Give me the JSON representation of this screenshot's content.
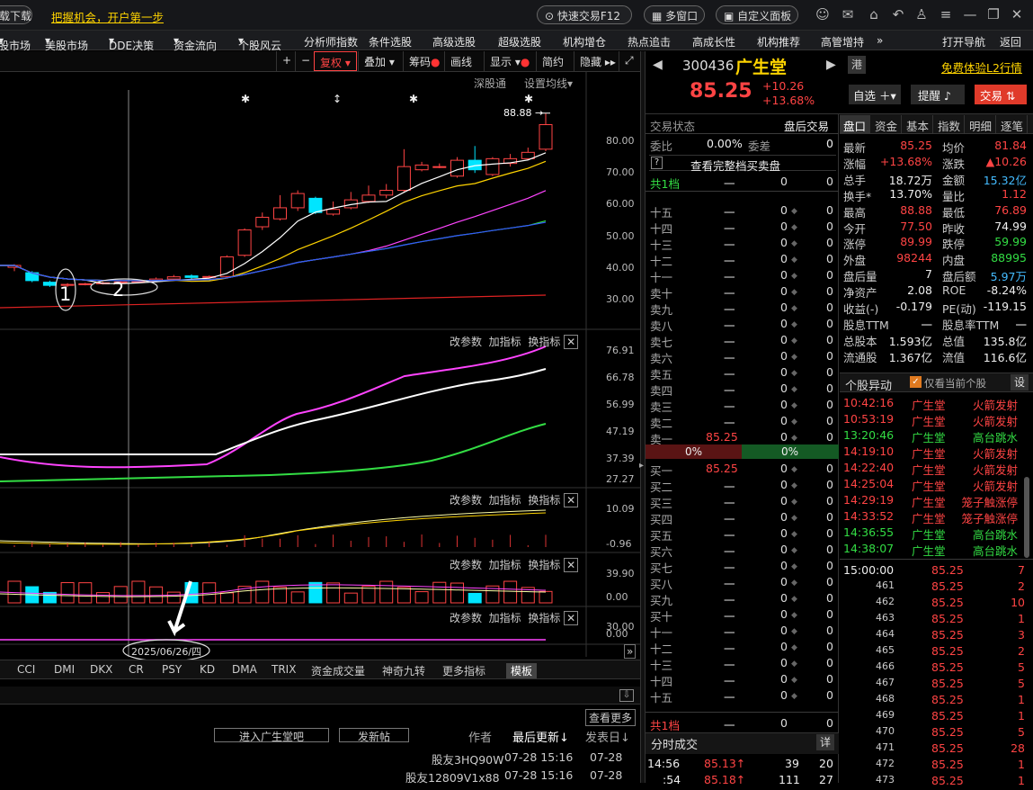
{
  "topbar": {
    "download": "载下载",
    "slogan": "把握机会，开户第一步",
    "quick_trade": "快速交易F12",
    "multi_window": "多窗口",
    "custom_panel": "自定义面板"
  },
  "menu": [
    "股市场",
    "美股市场",
    "DDE决策",
    "资金流向",
    "个股风云",
    "分析师指数",
    "条件选股",
    "高级选股",
    "超级选股",
    "机构增仓",
    "热点追击",
    "高成长性",
    "机构推荐",
    "高管增持",
    "»",
    "打开导航",
    "返回"
  ],
  "chart_toolbar": {
    "restore": "复权",
    "overlay": "叠加",
    "chips": "筹码",
    "draw": "画线",
    "display": "显示",
    "simple": "简约",
    "hide": "隐藏"
  },
  "chart_top": {
    "shgt": "深股通",
    "set_ma": "设置均线",
    "high_label": "88.88"
  },
  "price_axis": [
    "80.00",
    "70.00",
    "60.00",
    "50.00",
    "40.00",
    "30.00"
  ],
  "ind1_axis": [
    "76.91",
    "66.78",
    "56.99",
    "47.19",
    "37.39",
    "27.27"
  ],
  "ind2_axis": [
    "10.09",
    "-0.96"
  ],
  "ind3_axis": [
    "39.90",
    "0.00"
  ],
  "ind4_axis": [
    "30.00",
    "0.00"
  ],
  "ind_controls": {
    "params": "改参数",
    "add": "加指标",
    "switch": "换指标"
  },
  "annotations": {
    "one": "1",
    "two": "2",
    "date": "2025/06/26/四"
  },
  "indicator_tabs": [
    "CCI",
    "DMI",
    "DKX",
    "CR",
    "PSY",
    "KD",
    "DMA",
    "TRIX",
    "资金成交量",
    "神奇九转",
    "更多指标",
    "模板"
  ],
  "forum": {
    "enter": "进入广生堂吧",
    "post": "发新帖",
    "author": "作者",
    "last_update": "最后更新↓",
    "post_date": "发表日",
    "more": "查看更多",
    "rows": [
      {
        "author": "股友3HQ90W",
        "last": "07-28 15:16",
        "date": "07-28"
      },
      {
        "author": "股友12809V1x88",
        "last": "07-28 15:16",
        "date": "07-28"
      }
    ]
  },
  "stock": {
    "code": "300436",
    "name": "广生堂",
    "market": "港",
    "l2": "免费体验L2行情",
    "price": "85.25",
    "change": "+10.26",
    "pct": "+13.68%",
    "watch": "自选",
    "alert": "提醒",
    "trade": "交易"
  },
  "order_book": {
    "status_label": "交易状态",
    "status": "盘后交易",
    "ratio_label": "委比",
    "ratio": "0.00%",
    "diff_label": "委差",
    "diff": "0",
    "full_depth": "查看完整档买卖盘",
    "total_label": "共1档",
    "total_vol": "0",
    "total_n": "0",
    "sell": [
      {
        "l": "十五"
      },
      {
        "l": "十四"
      },
      {
        "l": "十三"
      },
      {
        "l": "十二"
      },
      {
        "l": "十一"
      },
      {
        "l": "卖十"
      },
      {
        "l": "卖九"
      },
      {
        "l": "卖八"
      },
      {
        "l": "卖七"
      },
      {
        "l": "卖六"
      },
      {
        "l": "卖五"
      },
      {
        "l": "卖四"
      },
      {
        "l": "卖三"
      },
      {
        "l": "卖二"
      },
      {
        "l": "卖一",
        "p": "85.25"
      }
    ],
    "bar_left": "0%",
    "bar_right": "0%",
    "buy": [
      {
        "l": "买一",
        "p": "85.25"
      },
      {
        "l": "买二"
      },
      {
        "l": "买三"
      },
      {
        "l": "买四"
      },
      {
        "l": "买五"
      },
      {
        "l": "买六"
      },
      {
        "l": "买七"
      },
      {
        "l": "买八"
      },
      {
        "l": "买九"
      },
      {
        "l": "买十"
      },
      {
        "l": "十一"
      },
      {
        "l": "十二"
      },
      {
        "l": "十三"
      },
      {
        "l": "十四"
      },
      {
        "l": "十五"
      }
    ],
    "dash": "一",
    "zero": "0",
    "bottom_total": "共1档"
  },
  "time_trade": {
    "title": "分时成交",
    "detail": "详",
    "rows": [
      {
        "t": "14:56",
        "p": "85.13↑",
        "v": "39",
        "n": "20"
      },
      {
        "t": ":54",
        "p": "85.18↑",
        "v": "111",
        "n": "27"
      }
    ]
  },
  "quote_tabs": [
    "盘口",
    "资金",
    "基本",
    "指数",
    "明细",
    "逐笔"
  ],
  "quote": [
    [
      {
        "k": "最新",
        "v": "85.25",
        "c": "red"
      },
      {
        "k": "均价",
        "v": "81.84",
        "c": "red"
      }
    ],
    [
      {
        "k": "涨幅",
        "v": "+13.68%",
        "c": "red"
      },
      {
        "k": "涨跌",
        "v": "▲10.26",
        "c": "red"
      }
    ],
    [
      {
        "k": "总手",
        "v": "18.72万",
        "c": "white"
      },
      {
        "k": "金额",
        "v": "15.32亿",
        "c": "blue"
      }
    ],
    [
      {
        "k": "换手*",
        "v": "13.70%",
        "c": "white"
      },
      {
        "k": "量比",
        "v": "1.12",
        "c": "red"
      }
    ],
    [
      {
        "k": "最高",
        "v": "88.88",
        "c": "red"
      },
      {
        "k": "最低",
        "v": "76.89",
        "c": "red"
      }
    ],
    [
      {
        "k": "今开",
        "v": "77.50",
        "c": "red"
      },
      {
        "k": "昨收",
        "v": "74.99",
        "c": "white"
      }
    ],
    [
      {
        "k": "涨停",
        "v": "89.99",
        "c": "red"
      },
      {
        "k": "跌停",
        "v": "59.99",
        "c": "green"
      }
    ],
    [
      {
        "k": "外盘",
        "v": "98244",
        "c": "red"
      },
      {
        "k": "内盘",
        "v": "88995",
        "c": "green"
      }
    ],
    [
      {
        "k": "盘后量",
        "v": "7",
        "c": "white"
      },
      {
        "k": "盘后额",
        "v": "5.97万",
        "c": "blue"
      }
    ],
    [
      {
        "k": "净资产",
        "v": "2.08",
        "c": "white"
      },
      {
        "k": "ROE",
        "v": "-8.24%",
        "c": "white"
      }
    ],
    [
      {
        "k": "收益(-)",
        "v": "-0.179",
        "c": "white"
      },
      {
        "k": "PE(动)",
        "v": "-119.15",
        "c": "white"
      }
    ],
    [
      {
        "k": "股息TTM",
        "v": "一",
        "c": "white"
      },
      {
        "k": "股息率TTM",
        "v": "一",
        "c": "white"
      }
    ],
    [
      {
        "k": "总股本",
        "v": "1.593亿",
        "c": "white"
      },
      {
        "k": "总值",
        "v": "135.8亿",
        "c": "white"
      }
    ],
    [
      {
        "k": "流通股",
        "v": "1.367亿",
        "c": "white"
      },
      {
        "k": "流值",
        "v": "116.6亿",
        "c": "white"
      }
    ]
  ],
  "movers": {
    "title": "个股异动",
    "only_current": "仅看当前个股",
    "settings": "设",
    "rows": [
      {
        "t": "10:42:16",
        "n": "广生堂",
        "e": "火箭发射",
        "c": "red"
      },
      {
        "t": "10:53:19",
        "n": "广生堂",
        "e": "火箭发射",
        "c": "red"
      },
      {
        "t": "13:20:46",
        "n": "广生堂",
        "e": "高台跳水",
        "c": "green"
      },
      {
        "t": "14:19:10",
        "n": "广生堂",
        "e": "火箭发射",
        "c": "red"
      },
      {
        "t": "14:22:40",
        "n": "广生堂",
        "e": "火箭发射",
        "c": "red"
      },
      {
        "t": "14:25:04",
        "n": "广生堂",
        "e": "火箭发射",
        "c": "red"
      },
      {
        "t": "14:29:19",
        "n": "广生堂",
        "e": "笼子触涨停",
        "c": "red"
      },
      {
        "t": "14:33:52",
        "n": "广生堂",
        "e": "笼子触涨停",
        "c": "red"
      },
      {
        "t": "14:36:55",
        "n": "广生堂",
        "e": "高台跳水",
        "c": "green"
      },
      {
        "t": "14:38:07",
        "n": "广生堂",
        "e": "高台跳水",
        "c": "green"
      }
    ]
  },
  "ticks": [
    {
      "t": "15:00:00",
      "p": "85.25",
      "v": "7"
    },
    {
      "t": "461",
      "p": "85.25",
      "v": "2"
    },
    {
      "t": "462",
      "p": "85.25",
      "v": "10"
    },
    {
      "t": "463",
      "p": "85.25",
      "v": "1"
    },
    {
      "t": "464",
      "p": "85.25",
      "v": "3"
    },
    {
      "t": "465",
      "p": "85.25",
      "v": "2"
    },
    {
      "t": "466",
      "p": "85.25",
      "v": "5"
    },
    {
      "t": "467",
      "p": "85.25",
      "v": "5"
    },
    {
      "t": "468",
      "p": "85.25",
      "v": "1"
    },
    {
      "t": "469",
      "p": "85.25",
      "v": "1"
    },
    {
      "t": "470",
      "p": "85.25",
      "v": "5"
    },
    {
      "t": "471",
      "p": "85.25",
      "v": "28"
    },
    {
      "t": "472",
      "p": "85.25",
      "v": "1"
    },
    {
      "t": "473",
      "p": "85.25",
      "v": "1"
    }
  ],
  "chart_data": {
    "type": "candlestick",
    "y_ticks": [
      80,
      70,
      60,
      50,
      40,
      30
    ],
    "high_marker": 88.88,
    "candles": [
      [
        40.2,
        40.8,
        39.0,
        41.2
      ],
      [
        38.5,
        36.0,
        35.5,
        39.0
      ],
      [
        35.5,
        34.5,
        34.0,
        36.0
      ],
      [
        34.5,
        34.8,
        34.0,
        35.2
      ],
      [
        34.8,
        35.0,
        34.5,
        35.3
      ],
      [
        35.0,
        35.3,
        34.8,
        35.6
      ],
      [
        35.3,
        35.6,
        35.0,
        36.0
      ],
      [
        35.6,
        35.8,
        35.2,
        36.4
      ],
      [
        35.8,
        36.5,
        35.5,
        37.0
      ],
      [
        36.5,
        37.2,
        36.0,
        37.8
      ],
      [
        37.5,
        37.0,
        36.5,
        38.0
      ],
      [
        37.0,
        37.3,
        36.8,
        37.6
      ],
      [
        37.3,
        43.5,
        37.0,
        44.0
      ],
      [
        44.0,
        52.0,
        43.5,
        52.5
      ],
      [
        53.0,
        56.0,
        52.0,
        57.5
      ],
      [
        55.5,
        59.0,
        55.0,
        63.0
      ],
      [
        59.0,
        63.5,
        58.0,
        64.5
      ],
      [
        62.0,
        57.5,
        57.0,
        62.5
      ],
      [
        57.0,
        58.5,
        56.5,
        61.0
      ],
      [
        59.0,
        61.5,
        58.5,
        64.0
      ],
      [
        61.0,
        63.0,
        60.5,
        66.0
      ],
      [
        63.0,
        64.5,
        62.0,
        66.5
      ],
      [
        64.5,
        72.0,
        64.0,
        77.5
      ],
      [
        71.0,
        72.5,
        70.5,
        73.5
      ],
      [
        72.0,
        72.0,
        71.5,
        73.0
      ],
      [
        69.0,
        74.0,
        68.5,
        75.0
      ],
      [
        74.0,
        71.0,
        70.0,
        78.5
      ],
      [
        69.5,
        74.5,
        69.0,
        75.0
      ],
      [
        73.0,
        74.5,
        72.0,
        76.0
      ],
      [
        74.5,
        76.5,
        74.0,
        78.0
      ],
      [
        77.5,
        85.25,
        76.89,
        88.88
      ]
    ]
  }
}
